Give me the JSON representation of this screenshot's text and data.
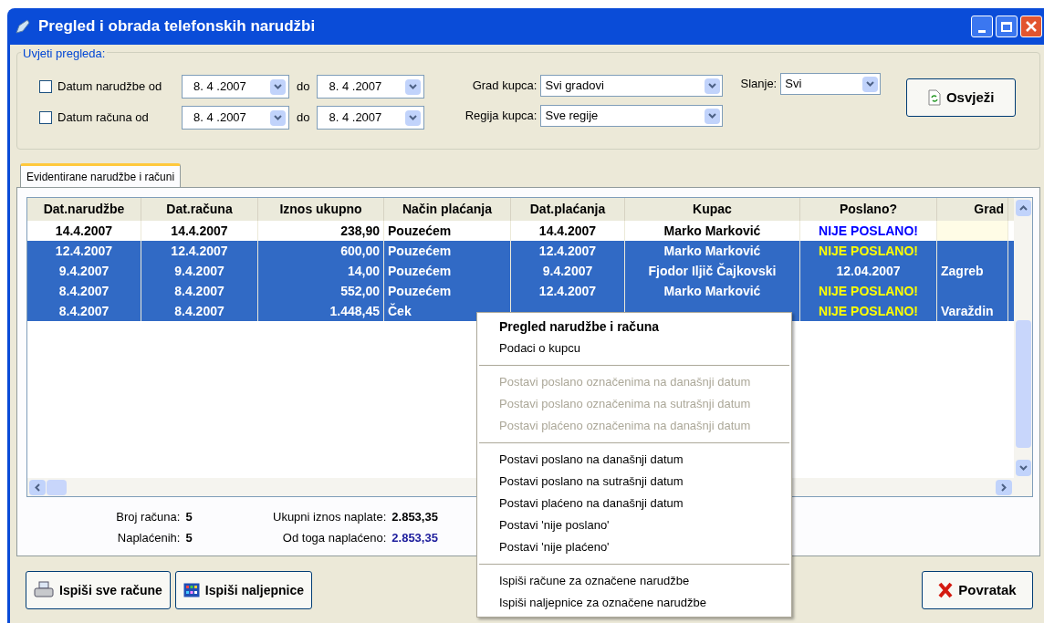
{
  "window": {
    "title": "Pregled i obrada telefonskih narudžbi"
  },
  "filters": {
    "legend": "Uvjeti pregleda:",
    "date_ranges": [
      {
        "label": "Datum narudžbe od",
        "checked": false,
        "from": "8. 4 .2007",
        "to_label": "do",
        "to": "8. 4 .2007"
      },
      {
        "label": "Datum računa od",
        "checked": false,
        "from": "8. 4 .2007",
        "to_label": "do",
        "to": "8. 4 .2007"
      }
    ],
    "city": {
      "label": "Grad kupca:",
      "value": "Svi gradovi"
    },
    "region": {
      "label": "Regija kupca:",
      "value": "Sve regije"
    },
    "shipping": {
      "label": "Slanje:",
      "value": "Svi"
    },
    "refresh_button": "Osvježi"
  },
  "tabs": [
    {
      "label": "Evidentirane narudžbe i računi",
      "selected": true
    }
  ],
  "table": {
    "columns": [
      "Dat.narudžbe",
      "Dat.računa",
      "Iznos ukupno",
      "Način plaćanja",
      "Dat.plaćanja",
      "Kupac",
      "Poslano?",
      "Grad"
    ],
    "rows": [
      {
        "selected": false,
        "order_date": "14.4.2007",
        "invoice_date": "14.4.2007",
        "amount": "238,90",
        "payment": "Pouzećem",
        "paid_date": "14.4.2007",
        "customer": "Marko Marković",
        "sent": {
          "kind": "not_sent",
          "text": "NIJE POSLANO!"
        },
        "city": ""
      },
      {
        "selected": true,
        "order_date": "12.4.2007",
        "invoice_date": "12.4.2007",
        "amount": "600,00",
        "payment": "Pouzećem",
        "paid_date": "12.4.2007",
        "customer": "Marko Marković",
        "sent": {
          "kind": "not_sent",
          "text": "NIJE POSLANO!"
        },
        "city": ""
      },
      {
        "selected": true,
        "order_date": "9.4.2007",
        "invoice_date": "9.4.2007",
        "amount": "14,00",
        "payment": "Pouzećem",
        "paid_date": "9.4.2007",
        "customer": "Fjodor Iljič Čajkovski",
        "sent": {
          "kind": "date",
          "text": "12.04.2007"
        },
        "city": "Zagreb"
      },
      {
        "selected": true,
        "order_date": "8.4.2007",
        "invoice_date": "8.4.2007",
        "amount": "552,00",
        "payment": "Pouzećem",
        "paid_date": "12.4.2007",
        "customer": "Marko Marković",
        "sent": {
          "kind": "not_sent",
          "text": "NIJE POSLANO!"
        },
        "city": ""
      },
      {
        "selected": true,
        "order_date": "8.4.2007",
        "invoice_date": "8.4.2007",
        "amount": "1.448,45",
        "payment": "Ček",
        "paid_date": "",
        "customer": "",
        "sent": {
          "kind": "not_sent",
          "text": "NIJE POSLANO!"
        },
        "city": "Varaždin"
      }
    ]
  },
  "summary": {
    "left": [
      {
        "label": "Broj računa:",
        "value": "5",
        "highlight": false
      },
      {
        "label": "Naplaćenih:",
        "value": "5",
        "highlight": false
      }
    ],
    "right": [
      {
        "label": "Ukupni iznos naplate:",
        "value": "2.853,35",
        "highlight": false
      },
      {
        "label": "Od toga naplaćeno:",
        "value": "2.853,35",
        "highlight": true
      }
    ]
  },
  "buttons": [
    {
      "kind": "print",
      "label": "Ispiši sve račune"
    },
    {
      "kind": "labels",
      "label": "Ispiši naljepnice"
    }
  ],
  "close_button": "Povratak",
  "context_menu": [
    {
      "kind": "item",
      "label": "Pregled narudžbe i računa",
      "bold": true,
      "disabled": false
    },
    {
      "kind": "item",
      "label": "Podaci o kupcu",
      "bold": false,
      "disabled": false
    },
    {
      "kind": "separator"
    },
    {
      "kind": "item",
      "label": "Postavi poslano označenima na današnji datum",
      "bold": false,
      "disabled": true
    },
    {
      "kind": "item",
      "label": "Postavi poslano označenima na sutrašnji datum",
      "bold": false,
      "disabled": true
    },
    {
      "kind": "item",
      "label": "Postavi plaćeno označenima na današnji datum",
      "bold": false,
      "disabled": true
    },
    {
      "kind": "separator"
    },
    {
      "kind": "item",
      "label": "Postavi poslano na današnji datum",
      "bold": false,
      "disabled": false
    },
    {
      "kind": "item",
      "label": "Postavi poslano na sutrašnji datum",
      "bold": false,
      "disabled": false
    },
    {
      "kind": "item",
      "label": "Postavi plaćeno na današnji datum",
      "bold": false,
      "disabled": false
    },
    {
      "kind": "item",
      "label": "Postavi 'nije poslano'",
      "bold": false,
      "disabled": false
    },
    {
      "kind": "item",
      "label": "Postavi 'nije plaćeno'",
      "bold": false,
      "disabled": false
    },
    {
      "kind": "separator"
    },
    {
      "kind": "item",
      "label": "Ispiši račune za označene narudžbe",
      "bold": false,
      "disabled": false
    },
    {
      "kind": "item",
      "label": "Ispiši naljepnice za označene narudžbe",
      "bold": false,
      "disabled": false
    }
  ]
}
